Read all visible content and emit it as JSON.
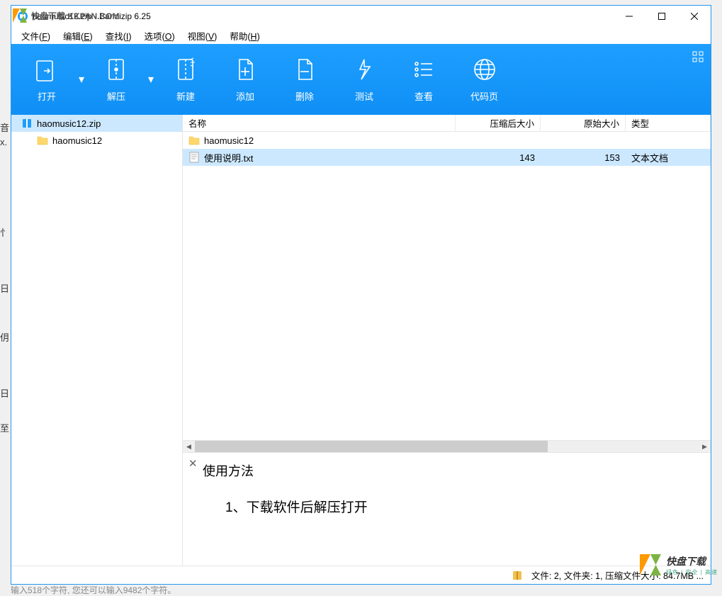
{
  "window": {
    "title": "haomusic12.zip - Bandizip 6.25"
  },
  "menubar": {
    "items": [
      {
        "label": "文件",
        "key": "F"
      },
      {
        "label": "编辑",
        "key": "E"
      },
      {
        "label": "查找",
        "key": "I"
      },
      {
        "label": "选项",
        "key": "O"
      },
      {
        "label": "视图",
        "key": "V"
      },
      {
        "label": "帮助",
        "key": "H"
      }
    ]
  },
  "toolbar": {
    "open": "打开",
    "extract": "解压",
    "new": "新建",
    "add": "添加",
    "delete": "删除",
    "test": "测试",
    "view": "查看",
    "codepage": "代码页"
  },
  "sidebar": {
    "root": "haomusic12.zip",
    "child": "haomusic12"
  },
  "columns": {
    "name": "名称",
    "compressed": "压缩后大小",
    "original": "原始大小",
    "type": "类型"
  },
  "rows": [
    {
      "name": "haomusic12",
      "compressed": "",
      "original": "",
      "type": "",
      "kind": "folder",
      "selected": false
    },
    {
      "name": "使用说明.txt",
      "compressed": "143",
      "original": "153",
      "type": "文本文档",
      "kind": "txt",
      "selected": true
    }
  ],
  "preview": {
    "title": "使用方法",
    "body": "1、下载软件后解压打开"
  },
  "statusbar": {
    "text": "文件: 2, 文件夹: 1, 压缩文件大小: 84.7MB ..."
  },
  "watermark": {
    "tl_text": "快盘下载 KKPAN.COM",
    "br_main": "快盘下载",
    "br_sub": "绿色 | 安全 | 高速"
  },
  "bg_bottom": "输入518个字符, 您还可以输入9482个字符。"
}
